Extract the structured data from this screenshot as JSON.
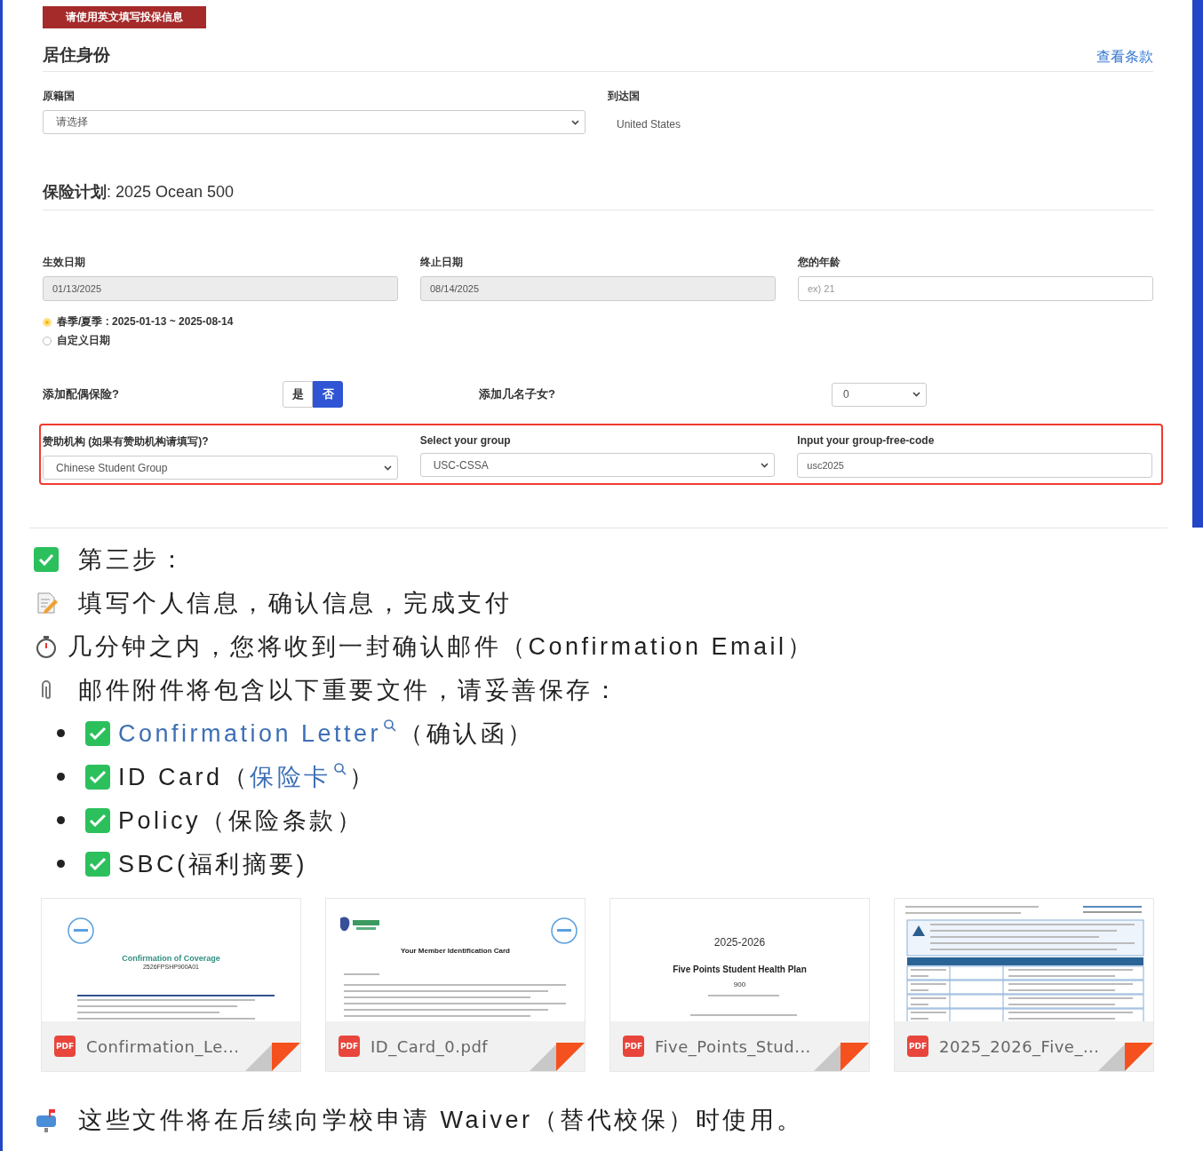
{
  "banner": "请使用英文填写投保信息",
  "residence": {
    "title": "居住身份",
    "terms_link": "查看条款",
    "origin": {
      "label": "原籍国",
      "value": "请选择"
    },
    "destination": {
      "label": "到达国",
      "value": "United States"
    }
  },
  "plan": {
    "title": "**保险计划**: 2025 Ocean 500"
  },
  "date_fields": [
    {
      "label": "生效日期",
      "value": "01/13/2025",
      "disabled": true
    },
    {
      "label": "终止日期",
      "value": "08/14/2025",
      "disabled": true
    },
    {
      "label": "您的年龄",
      "placeholder": "ex) 21",
      "disabled": false
    }
  ],
  "date_options": [
    {
      "label": "春季/夏季 : 2025-01-13 ~ 2025-08-14",
      "selected": true
    },
    {
      "label": "自定义日期",
      "selected": false
    }
  ],
  "spouse": {
    "label": "添加配偶保险?",
    "options": [
      {
        "label": "是",
        "selected": false
      },
      {
        "label": "否",
        "selected": true
      }
    ]
  },
  "children": {
    "label": "添加几名子女?",
    "value": "0"
  },
  "sponsor": {
    "highlighted": true,
    "fields": [
      {
        "kind": "select",
        "label": "赞助机构 (如果有赞助机构请填写)?",
        "value": "Chinese Student Group"
      },
      {
        "kind": "select",
        "label": "Select your group",
        "value": "USC-CSSA"
      },
      {
        "kind": "input",
        "label": "Input your group-free-code",
        "value": "usc2025"
      }
    ]
  },
  "steps": [
    {
      "kind": "check",
      "text": "第三步："
    },
    {
      "kind": "memo",
      "text": "填写个人信息，确认信息，完成支付"
    },
    {
      "kind": "timer",
      "text": "几分钟之内，您将收到一封确认邮件（Confirmation Email）"
    },
    {
      "kind": "clip",
      "text": "邮件附件将包含以下重要文件，请妥善保存："
    }
  ],
  "documents": [
    {
      "checked": true,
      "parts": [
        {
          "text": "Confirmation Letter",
          "link": true,
          "search": true
        },
        {
          "text": "（确认函）",
          "link": false,
          "search": false
        }
      ]
    },
    {
      "checked": true,
      "parts": [
        {
          "text": "ID Card（",
          "link": false,
          "search": false
        },
        {
          "text": "保险卡",
          "link": true,
          "search": true
        },
        {
          "text": "）",
          "link": false,
          "search": false
        }
      ]
    },
    {
      "checked": true,
      "parts": [
        {
          "text": "Policy（保险条款）",
          "link": false,
          "search": false
        }
      ]
    },
    {
      "checked": true,
      "parts": [
        {
          "text": "SBC(福利摘要)",
          "link": false,
          "search": false
        }
      ]
    }
  ],
  "files": [
    {
      "name": "Confirmation_Le...",
      "badge": "PDF",
      "preview": {
        "kind": "coverage",
        "title": "Confirmation of Coverage",
        "subtitle": "2526FPSHP900A01"
      }
    },
    {
      "name": "ID_Card_0.pdf",
      "badge": "PDF",
      "preview": {
        "kind": "id_card",
        "title": "Your Member Identification Card"
      }
    },
    {
      "name": "Five_Points_Stud...",
      "badge": "PDF",
      "preview": {
        "kind": "plan",
        "year": "2025-2026",
        "title": "Five Points Student Health Plan",
        "subtitle": "900"
      }
    },
    {
      "name": "2025_2026_Five_...",
      "badge": "PDF",
      "preview": {
        "kind": "sbc"
      }
    }
  ],
  "footer": {
    "text": "这些文件将在后续向学校申请 Waiver（替代校保）时使用。"
  }
}
